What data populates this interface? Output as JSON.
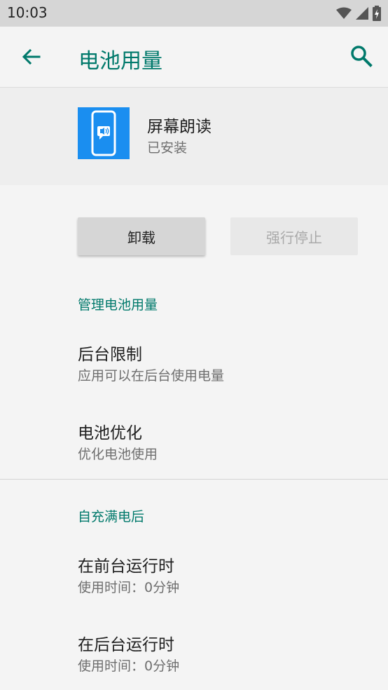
{
  "status_bar": {
    "time": "10:03"
  },
  "app_bar": {
    "title": "电池用量"
  },
  "app_header": {
    "name": "屏幕朗读",
    "status": "已安装"
  },
  "buttons": {
    "uninstall": "卸载",
    "force_stop": "强行停止"
  },
  "section_manage": {
    "title": "管理电池用量",
    "items": [
      {
        "title": "后台限制",
        "summary": "应用可以在后台使用电量"
      },
      {
        "title": "电池优化",
        "summary": "优化电池使用"
      }
    ]
  },
  "section_since_charge": {
    "title": "自充满电后",
    "items": [
      {
        "title": "在前台运行时",
        "summary": "使用时间：0分钟"
      },
      {
        "title": "在后台运行时",
        "summary": "使用时间：0分钟"
      }
    ]
  },
  "colors": {
    "accent": "#00796b",
    "app_icon": "#1a8ef0"
  }
}
